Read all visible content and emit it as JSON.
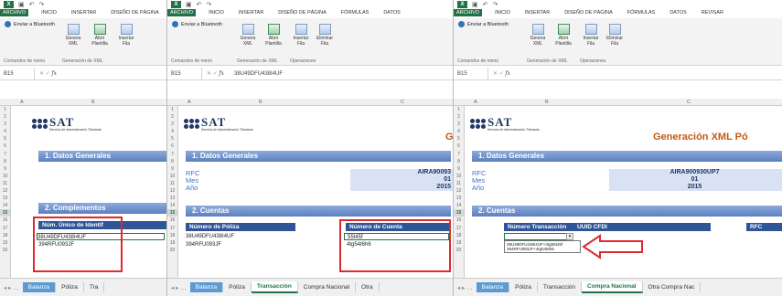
{
  "ribbon_tabs": [
    "ARCHIVO",
    "INICIO",
    "INSERTAR",
    "DISEÑO DE PÁGINA",
    "FÓRMULAS",
    "DATOS",
    "REVISAR"
  ],
  "ribbon_items": {
    "bluetooth": "Enviar a Bluetooth",
    "genera": "Genera XML",
    "abrir": "Abrir Plantilla",
    "insertar": "Insertar Fila",
    "eliminar": "Eliminar Fila"
  },
  "ribbon_groups": {
    "menu": "Comandos de menú",
    "xml": "Generación de XML",
    "ops": "Operaciones"
  },
  "name_box": "B15",
  "formula": "38U49DFU438I4UF",
  "column_labels": [
    "A",
    "B",
    "C"
  ],
  "rows": [
    "1",
    "2",
    "3",
    "4",
    "5",
    "6",
    "7",
    "8",
    "9",
    "10",
    "11",
    "12",
    "13",
    "14",
    "15",
    "16",
    "17",
    "18",
    "19",
    "20"
  ],
  "sat": {
    "word": "SAT",
    "subtitle": "Servicio de Administración Tributaria"
  },
  "title": "Generación XML Pó",
  "title_g": "G",
  "datos": {
    "header": "1. Datos Generales",
    "rfc_label": "RFC",
    "mes_label": "Mes",
    "anio_label": "Año",
    "rfc": "AIRA900930UP7",
    "rfc_trunc": "AIRA90093",
    "mes": "01",
    "anio": "2015"
  },
  "complementos": {
    "header": "2. Complementos",
    "col": "Núm. Único de Identif",
    "r1": "38U49DFU438I4UF",
    "r2": "394RFU093JF"
  },
  "cuentas": {
    "header": "2. Cuentas",
    "col1": "Número de Póliza",
    "col2": "Número de Cuenta",
    "c1r1": "38U49DFU438I4UF",
    "c1r2": "394RFU093JF",
    "c2r1": "55t45f",
    "c2r2": "4tg54t6h6",
    "col_trans": "Número Transacción",
    "col_uuid": "UUID CFDI",
    "col_rfc": "RFC"
  },
  "dropdown": [
    "38U49DFU438I4UF+4tg55t45f",
    "394RFU093JF+4tg54t6h6"
  ],
  "sheet_tabs": {
    "p1": [
      "Balanza",
      "Póliza",
      "Tra"
    ],
    "p2": [
      "Balanza",
      "Póliza",
      "Transacción",
      "Compra Nacional",
      "Otra"
    ],
    "p3": [
      "Balanza",
      "Póliza",
      "Transacción",
      "Compra Nacional",
      "Otra Compra Nac"
    ]
  }
}
